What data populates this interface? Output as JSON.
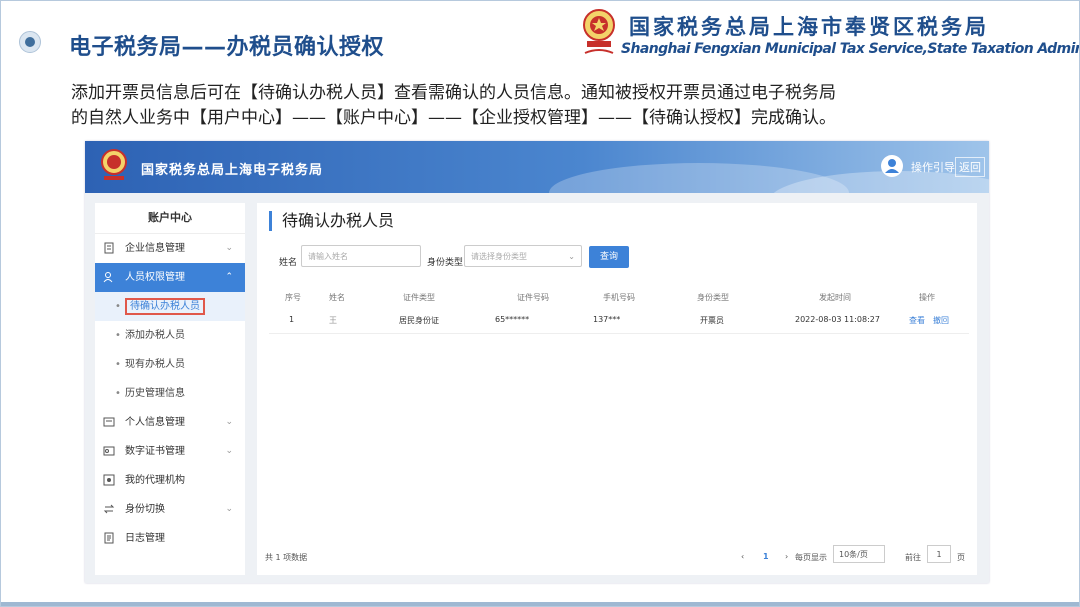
{
  "slide": {
    "title": "电子税务局——办税员确认授权",
    "bureau_cn": "国家税务总局上海市奉贤区税务局",
    "bureau_en": "Shanghai Fengxian Municipal Tax Service,State Taxation Administration",
    "desc_line1": "添加开票员信息后可在【待确认办税人员】查看需确认的人员信息。通知被授权开票员通过电子税务局",
    "desc_line2": "的自然人业务中【用户中心】——【账户中心】——【企业授权管理】——【待确认授权】完成确认。"
  },
  "colors": {
    "brand": "#1f4e8c",
    "accent": "#3d82d8",
    "highlight": "#e0584a"
  },
  "app": {
    "header_title": "国家税务总局上海电子税务局",
    "guide_label": "操作引导",
    "back_label": "返回",
    "user_icon": "user-circle-icon"
  },
  "sidebar": {
    "title": "账户中心",
    "items": [
      {
        "label": "企业信息管理",
        "icon": "building-icon",
        "chevron": "⌄"
      },
      {
        "label": "人员权限管理",
        "icon": "person-lock-icon",
        "chevron": "⌃",
        "active": true
      },
      {
        "label": "个人信息管理",
        "icon": "id-card-icon",
        "chevron": "⌄"
      },
      {
        "label": "数字证书管理",
        "icon": "certificate-icon",
        "chevron": "⌄"
      },
      {
        "label": "我的代理机构",
        "icon": "agency-icon"
      },
      {
        "label": "身份切换",
        "icon": "switch-icon",
        "chevron": "⌄"
      },
      {
        "label": "日志管理",
        "icon": "log-icon"
      }
    ],
    "subitems": [
      "待确认办税人员",
      "添加办税人员",
      "现有办税人员",
      "历史管理信息"
    ]
  },
  "main": {
    "title": "待确认办税人员",
    "filters": {
      "name_label": "姓名",
      "name_placeholder": "请输入姓名",
      "type_label": "身份类型",
      "type_placeholder": "请选择身份类型",
      "query_button": "查询"
    },
    "columns": [
      "序号",
      "姓名",
      "证件类型",
      "证件号码",
      "手机号码",
      "身份类型",
      "发起时间",
      "操作"
    ],
    "rows": [
      {
        "index": "1",
        "name": "王",
        "id_type": "居民身份证",
        "id_number": "65******",
        "phone": "137***",
        "identity": "开票员",
        "time": "2022-08-03 11:08:27",
        "action_view": "查看",
        "action_revoke": "撤回"
      }
    ],
    "footer": {
      "total": "共 1 项数据",
      "prev": "‹",
      "page": "1",
      "next": "›",
      "per_page_label": "每页显示",
      "per_page_value": "10条/页",
      "goto_label": "前往",
      "goto_value": "1",
      "page_unit": "页"
    }
  }
}
